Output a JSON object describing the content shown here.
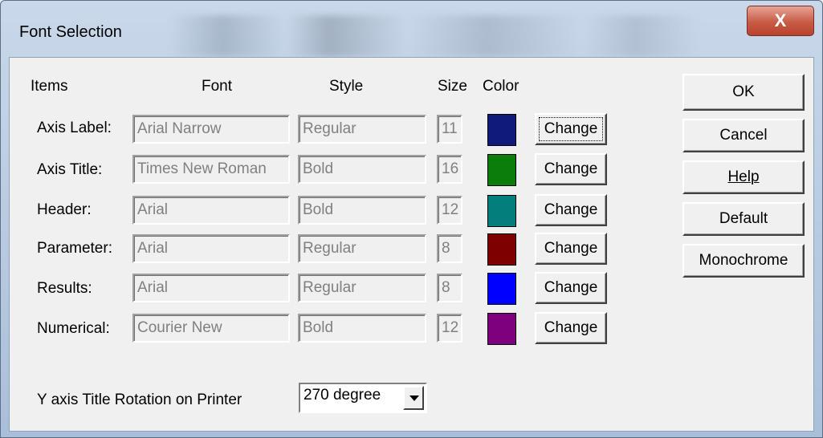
{
  "window": {
    "title": "Font Selection",
    "close_label": "X"
  },
  "headers": {
    "items": "Items",
    "font": "Font",
    "style": "Style",
    "size": "Size",
    "color": "Color"
  },
  "rows": [
    {
      "label": "Axis Label:",
      "font": "Arial Narrow",
      "style": "Regular",
      "size": "11",
      "color": "#0f1a7a",
      "button": "Change"
    },
    {
      "label": "Axis Title:",
      "font": "Times New Roman",
      "style": "Bold",
      "size": "16",
      "color": "#0a7d0a",
      "button": "Change"
    },
    {
      "label": "Header:",
      "font": "Arial",
      "style": "Bold",
      "size": "12",
      "color": "#047d7d",
      "button": "Change"
    },
    {
      "label": "Parameter:",
      "font": "Arial",
      "style": "Regular",
      "size": "8",
      "color": "#7f0000",
      "button": "Change"
    },
    {
      "label": "Results:",
      "font": "Arial",
      "style": "Regular",
      "size": "8",
      "color": "#0000ff",
      "button": "Change"
    },
    {
      "label": "Numerical:",
      "font": "Courier New",
      "style": "Bold",
      "size": "12",
      "color": "#7f007f",
      "button": "Change"
    }
  ],
  "buttons": {
    "ok": "OK",
    "cancel": "Cancel",
    "help": "Help",
    "default": "Default",
    "monochrome": "Monochrome"
  },
  "rotation": {
    "label": "Y axis Title Rotation on Printer",
    "value": "270 degree"
  }
}
